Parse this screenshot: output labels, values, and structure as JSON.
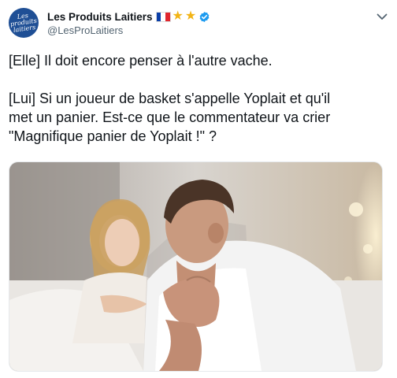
{
  "account": {
    "display_name": "Les Produits Laitiers",
    "handle": "@LesProLaitiers",
    "avatar_text": "Les produits laitiers",
    "badges": [
      "flag-france-icon",
      "star-icon",
      "star-icon",
      "verified-icon"
    ]
  },
  "tweet": {
    "line1": "[Elle] Il doit encore penser à l'autre vache.",
    "line2": "[Lui] Si un joueur de basket s'appelle Yoplait et qu'il",
    "line3": "met un panier. Est-ce que le commentateur va crier",
    "line4": "\"Magnifique panier de Yoplait !\" ?"
  },
  "colors": {
    "brand": "#1f4f95",
    "verified": "#1d9bf0",
    "star": "#f2b416",
    "text": "#0f1419",
    "muted": "#536471"
  }
}
